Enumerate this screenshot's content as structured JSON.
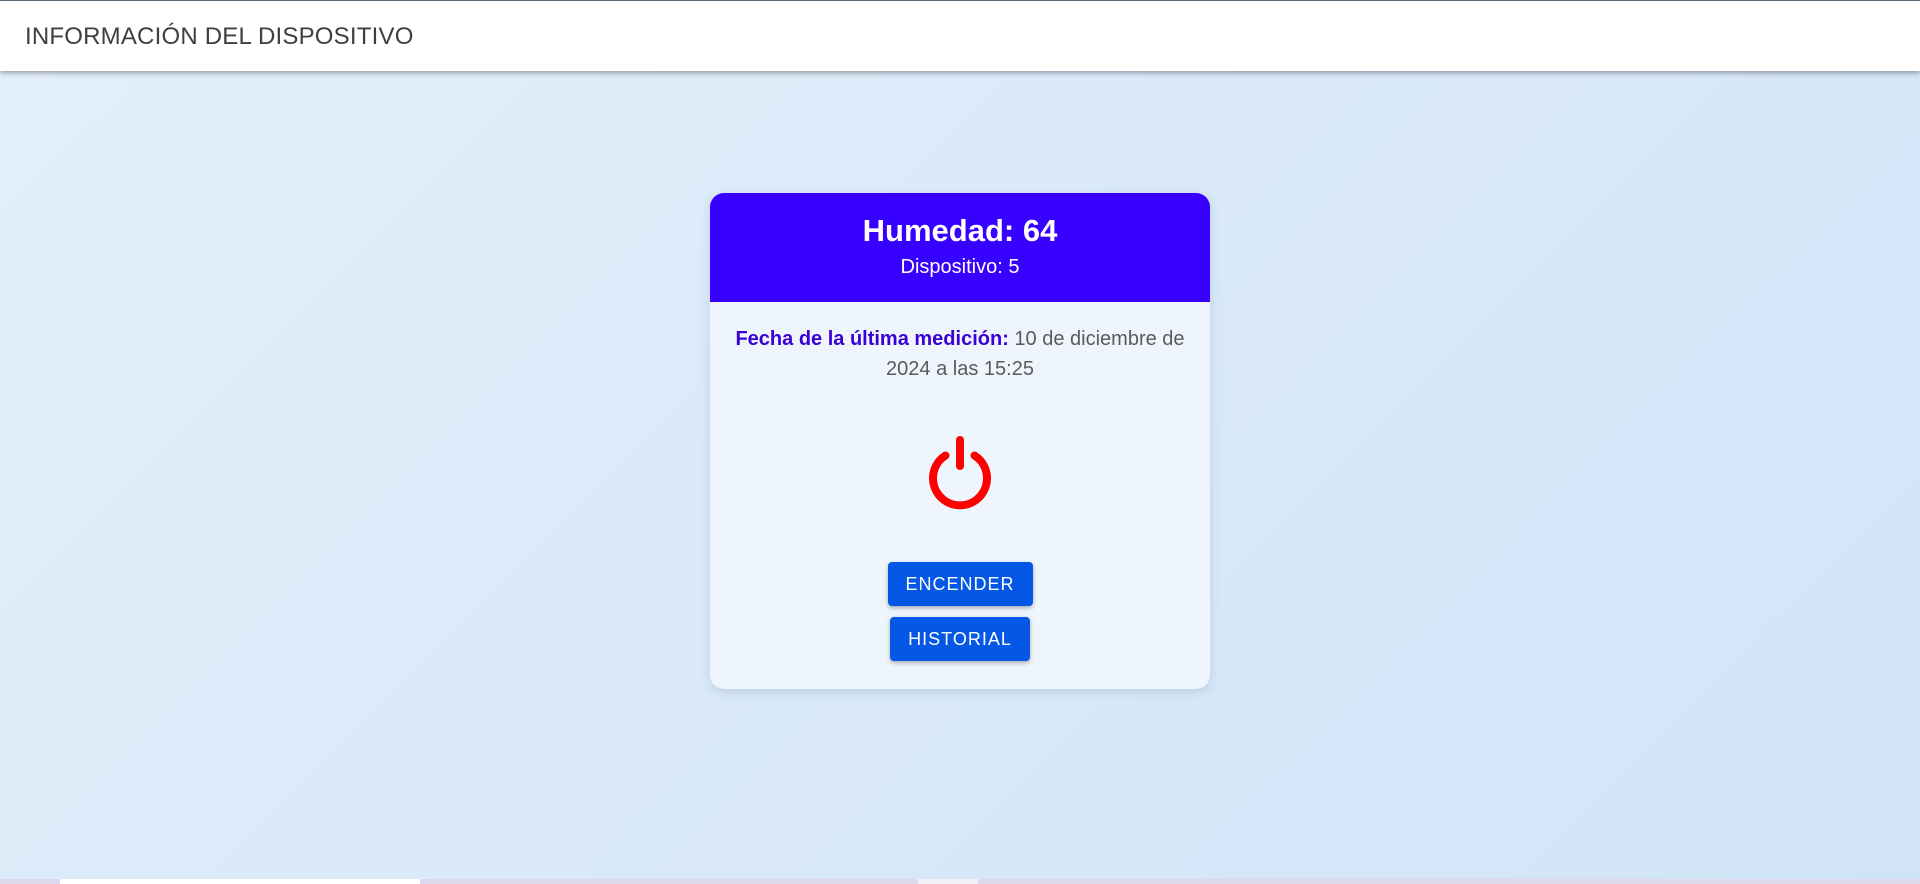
{
  "header": {
    "title": "INFORMACIÓN DEL DISPOSITIVO"
  },
  "card": {
    "title": "Humedad: 64",
    "subtitle": "Dispositivo: 5",
    "date_label": "Fecha de la última medición:",
    "date_value": "10 de diciembre de 2024 a las 15:25",
    "power_icon": "power-icon",
    "power_state_color": "#ff0000",
    "header_color": "#3700ff",
    "button_color": "#0557e6",
    "buttons": {
      "on_label": "Encender",
      "history_label": "Historial"
    }
  }
}
